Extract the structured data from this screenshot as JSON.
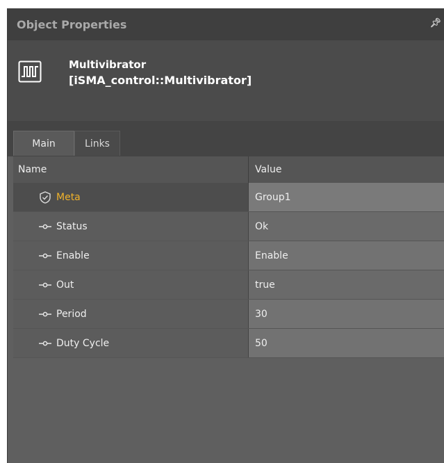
{
  "panel": {
    "title": "Object Properties",
    "pin_icon": "pin-icon"
  },
  "object": {
    "icon": "multivibrator-icon",
    "name": "Multivibrator",
    "type": "[iSMA_control::Multivibrator]"
  },
  "tabs": [
    {
      "label": "Main",
      "active": true
    },
    {
      "label": "Links",
      "active": false
    }
  ],
  "grid": {
    "headers": {
      "name": "Name",
      "value": "Value"
    },
    "rows": [
      {
        "icon": "shield-icon",
        "name": "Meta",
        "value": "Group1"
      },
      {
        "icon": "slot-icon",
        "name": "Status",
        "value": "Ok"
      },
      {
        "icon": "slot-icon",
        "name": "Enable",
        "value": "Enable"
      },
      {
        "icon": "slot-icon",
        "name": "Out",
        "value": "true"
      },
      {
        "icon": "slot-icon",
        "name": "Period",
        "value": "30"
      },
      {
        "icon": "slot-icon",
        "name": "Duty Cycle",
        "value": "50"
      }
    ]
  },
  "colors": {
    "meta_label": "#f0b22a",
    "panel_bg": "#5f5f5f",
    "title_bg": "#3f3f3f"
  }
}
